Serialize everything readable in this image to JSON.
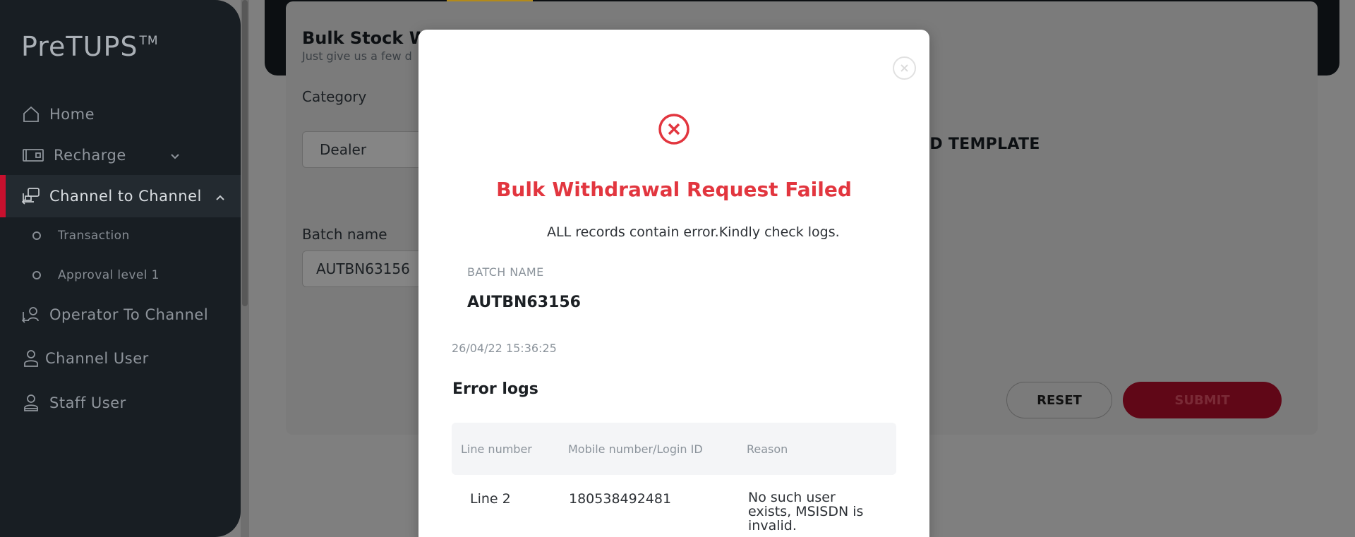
{
  "sidebar": {
    "brand": "PreTUPS",
    "brand_tm": "TM",
    "items": [
      {
        "label": "Home",
        "icon": "home-icon"
      },
      {
        "label": "Recharge",
        "icon": "recharge-icon"
      },
      {
        "label": "Channel to Channel",
        "icon": "channel-icon"
      },
      {
        "label": "Operator To Channel",
        "icon": "operator-icon"
      },
      {
        "label": "Channel User",
        "icon": "user-icon"
      },
      {
        "label": "Staff User",
        "icon": "staff-icon"
      }
    ],
    "sub_items": [
      {
        "label": "Transaction"
      },
      {
        "label": "Approval level 1"
      }
    ]
  },
  "page": {
    "title": "Bulk Stock Wi",
    "subtitle": "Just give us a few d",
    "category_label": "Category",
    "category_value": "Dealer",
    "batch_label": "Batch name",
    "batch_value": "AUTBN63156",
    "download_template": "AD TEMPLATE",
    "reset_label": "RESET",
    "submit_label": "SUBMIT"
  },
  "modal": {
    "title": "Bulk Withdrawal Request Failed",
    "message": "ALL records contain error.Kindly check logs.",
    "batch_label": "BATCH NAME",
    "batch_value": "AUTBN63156",
    "date": "26/04/22 15:36:25",
    "logs_title": "Error logs",
    "columns": [
      "Line number",
      "Mobile number/Login ID",
      "Reason"
    ],
    "rows": [
      {
        "line": "Line 2",
        "mobile": "180538492481",
        "reason": "No such user exists, MSISDN is invalid."
      }
    ]
  },
  "colors": {
    "accent_red": "#c8102e",
    "error_red": "#e2363f",
    "sidebar_bg": "#181e23"
  }
}
